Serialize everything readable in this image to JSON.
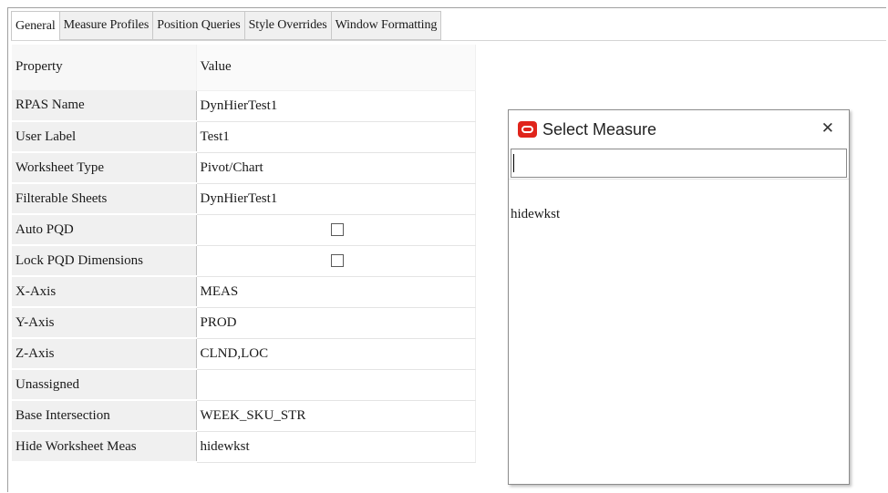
{
  "tabs": [
    {
      "label": "General",
      "active": true
    },
    {
      "label": "Measure Profiles",
      "active": false
    },
    {
      "label": "Position Queries",
      "active": false
    },
    {
      "label": "Style Overrides",
      "active": false
    },
    {
      "label": "Window Formatting",
      "active": false
    }
  ],
  "table": {
    "header": {
      "property": "Property",
      "value": "Value"
    },
    "rows": [
      {
        "property": "RPAS Name",
        "value": "DynHierTest1"
      },
      {
        "property": "User Label",
        "value": "Test1"
      },
      {
        "property": "Worksheet Type",
        "value": "Pivot/Chart"
      },
      {
        "property": "Filterable Sheets",
        "value": "DynHierTest1"
      },
      {
        "property": "Auto PQD",
        "value": "",
        "checked": false
      },
      {
        "property": "Lock PQD Dimensions",
        "value": "",
        "checked": false
      },
      {
        "property": "X-Axis",
        "value": "MEAS"
      },
      {
        "property": "Y-Axis",
        "value": "PROD"
      },
      {
        "property": "Z-Axis",
        "value": "CLND,LOC"
      },
      {
        "property": "Unassigned",
        "value": ""
      },
      {
        "property": "Base Intersection",
        "value": "WEEK_SKU_STR"
      },
      {
        "property": "Hide Worksheet Meas",
        "value": "hidewkst"
      }
    ]
  },
  "dialog": {
    "title": "Select Measure",
    "close_symbol": "✕",
    "search_value": "",
    "items": [
      "hidewkst"
    ],
    "icon": "oracle-logo-icon",
    "icon_color": "#e0241b"
  }
}
